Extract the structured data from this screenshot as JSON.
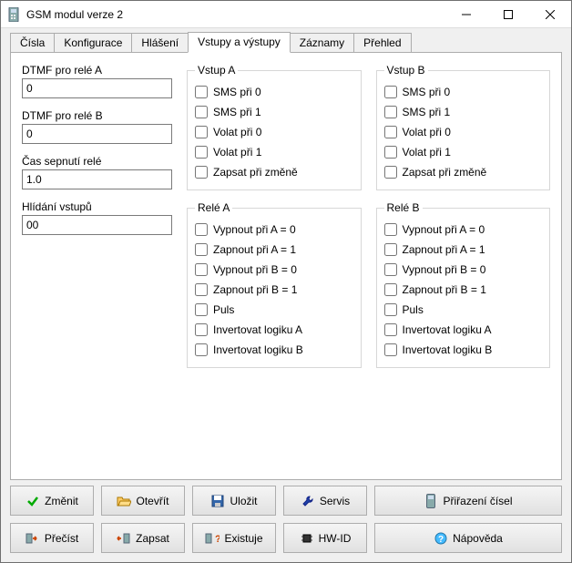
{
  "window": {
    "title": "GSM modul verze 2"
  },
  "tabs": [
    {
      "label": "Čísla"
    },
    {
      "label": "Konfigurace"
    },
    {
      "label": "Hlášení"
    },
    {
      "label": "Vstupy a výstupy",
      "active": true
    },
    {
      "label": "Záznamy"
    },
    {
      "label": "Přehled"
    }
  ],
  "fields": {
    "dtmf_a": {
      "label": "DTMF pro relé A",
      "value": "0"
    },
    "dtmf_b": {
      "label": "DTMF pro relé B",
      "value": "0"
    },
    "switch_time": {
      "label": "Čas sepnutí relé",
      "value": "1.0"
    },
    "input_guard": {
      "label": "Hlídání vstupů",
      "value": "00"
    }
  },
  "groups": {
    "input_a": {
      "legend": "Vstup A",
      "items": [
        {
          "label": "SMS při 0"
        },
        {
          "label": "SMS při 1"
        },
        {
          "label": "Volat při 0"
        },
        {
          "label": "Volat při 1"
        },
        {
          "label": "Zapsat při změně"
        }
      ]
    },
    "input_b": {
      "legend": "Vstup B",
      "items": [
        {
          "label": "SMS při 0"
        },
        {
          "label": "SMS při 1"
        },
        {
          "label": "Volat při 0"
        },
        {
          "label": "Volat při 1"
        },
        {
          "label": "Zapsat při změně"
        }
      ]
    },
    "relay_a": {
      "legend": "Relé A",
      "items": [
        {
          "label": "Vypnout při A = 0"
        },
        {
          "label": "Zapnout při A = 1"
        },
        {
          "label": "Vypnout při B = 0"
        },
        {
          "label": "Zapnout při B = 1"
        },
        {
          "label": "Puls"
        },
        {
          "label": "Invertovat logiku A"
        },
        {
          "label": "Invertovat logiku B"
        }
      ]
    },
    "relay_b": {
      "legend": "Relé B",
      "items": [
        {
          "label": "Vypnout při A = 0"
        },
        {
          "label": "Zapnout při A = 1"
        },
        {
          "label": "Vypnout při B = 0"
        },
        {
          "label": "Zapnout při B = 1"
        },
        {
          "label": "Puls"
        },
        {
          "label": "Invertovat logiku A"
        },
        {
          "label": "Invertovat logiku B"
        }
      ]
    }
  },
  "buttons": {
    "change": "Změnit",
    "open": "Otevřít",
    "save": "Uložit",
    "service": "Servis",
    "assign": "Přiřazení čísel",
    "read": "Přečíst",
    "write": "Zapsat",
    "exists": "Existuje",
    "hwid": "HW-ID",
    "help": "Nápověda"
  }
}
